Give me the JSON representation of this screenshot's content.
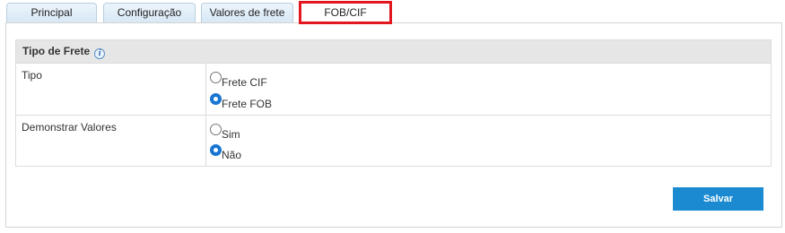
{
  "tabs": [
    {
      "label": "Principal"
    },
    {
      "label": "Configuração"
    },
    {
      "label": "Valores de frete"
    },
    {
      "label": "FOB/CIF",
      "active": true
    }
  ],
  "section": {
    "title": "Tipo de Frete",
    "info_icon": "i"
  },
  "fields": {
    "tipo": {
      "label": "Tipo",
      "options": [
        {
          "label": "Frete CIF",
          "checked": false
        },
        {
          "label": "Frete FOB",
          "checked": true
        }
      ]
    },
    "demonstrar": {
      "label": "Demonstrar Valores",
      "options": [
        {
          "label": "Sim",
          "checked": false
        },
        {
          "label": "Não",
          "checked": true
        }
      ]
    }
  },
  "actions": {
    "save_label": "Salvar"
  },
  "colors": {
    "active_tab_outline": "#e3171f",
    "radio_checked": "#1976d2",
    "save_button": "#1b8ad1"
  }
}
